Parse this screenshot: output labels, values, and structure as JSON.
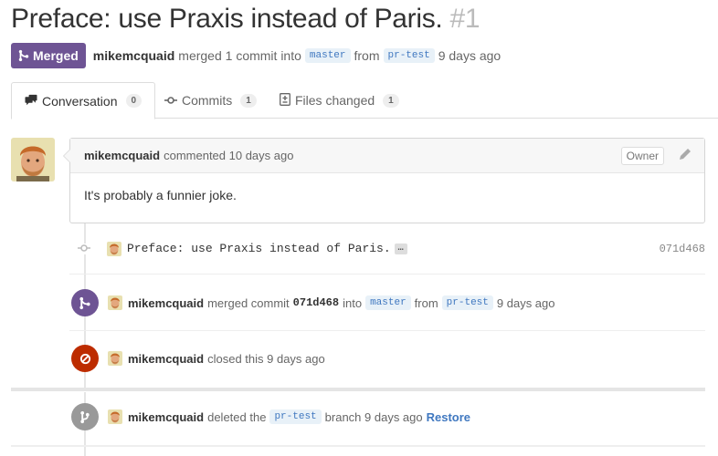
{
  "pr": {
    "title": "Preface: use Praxis instead of Paris.",
    "number": "#1",
    "state_label": "Merged",
    "author": "mikemcquaid",
    "summary_text": "merged 1 commit into",
    "base_branch": "master",
    "from_text": "from",
    "head_branch": "pr-test",
    "time": "9 days ago"
  },
  "tabs": [
    {
      "label": "Conversation",
      "count": "0",
      "icon": "comment-discussion-icon"
    },
    {
      "label": "Commits",
      "count": "1",
      "icon": "git-commit-icon"
    },
    {
      "label": "Files changed",
      "count": "1",
      "icon": "diff-icon"
    }
  ],
  "comment": {
    "author": "mikemcquaid",
    "action": "commented 10 days ago",
    "role": "Owner",
    "body": "It's probably a funnier joke."
  },
  "commit": {
    "message": "Preface: use Praxis instead of Paris.",
    "ellipsis": "…",
    "sha": "071d468"
  },
  "events": {
    "merged": {
      "user": "mikemcquaid",
      "text": "merged commit",
      "sha": "071d468",
      "into_text": "into",
      "base": "master",
      "from_text": "from",
      "head": "pr-test",
      "time": "9 days ago",
      "color": "#6e5494",
      "icon": "git-merge-icon"
    },
    "closed": {
      "user": "mikemcquaid",
      "text": "closed this 9 days ago",
      "color": "#bd2c00",
      "icon": "circle-slash-icon"
    },
    "deleted": {
      "user": "mikemcquaid",
      "text": "deleted the",
      "branch": "pr-test",
      "suffix": "branch 9 days ago",
      "restore": "Restore",
      "color": "#999999",
      "icon": "git-branch-icon"
    }
  }
}
